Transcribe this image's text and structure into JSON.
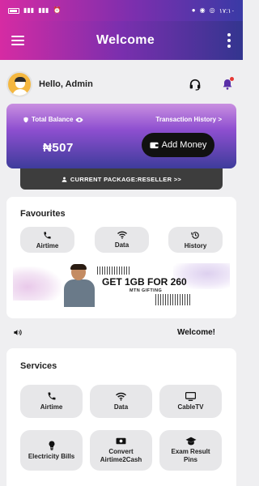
{
  "status_bar": {
    "time": "١٧:١٠"
  },
  "app_bar": {
    "title": "Welcome"
  },
  "greeting": {
    "text": "Hello, Admin"
  },
  "balance": {
    "label": "Total Balance",
    "amount": "₦507",
    "history_link": "Transaction History >",
    "add_money_label": "Add Money"
  },
  "package": {
    "label": "CURRENT PACKAGE:RESELLER >>"
  },
  "favourites": {
    "heading": "Favourites",
    "items": [
      {
        "label": "Airtime",
        "icon": "phone-icon"
      },
      {
        "label": "Data",
        "icon": "wifi-icon"
      },
      {
        "label": "History",
        "icon": "history-icon"
      }
    ]
  },
  "banner": {
    "headline": "GET 1GB FOR 260",
    "subtitle": "MTN GIFTING"
  },
  "marquee": {
    "text": "Welcome!"
  },
  "services": {
    "heading": "Services",
    "items": [
      {
        "label": "Airtime",
        "icon": "phone-icon"
      },
      {
        "label": "Data",
        "icon": "wifi-icon"
      },
      {
        "label": "CableTV",
        "icon": "tv-icon"
      },
      {
        "label": "Electricity Bills",
        "icon": "bulb-icon"
      },
      {
        "label": "Convert Airtime2Cash",
        "icon": "exchange-icon"
      },
      {
        "label": "Exam Result Pins",
        "icon": "graduation-cap-icon"
      }
    ]
  }
}
